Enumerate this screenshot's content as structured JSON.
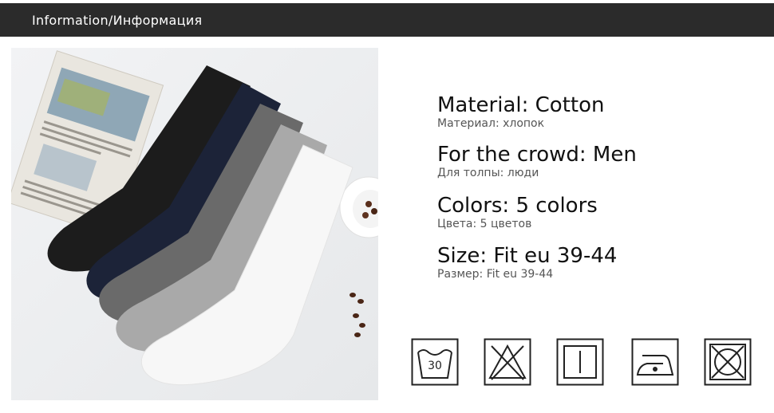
{
  "header": {
    "title": "Information/Информация"
  },
  "specs": [
    {
      "en": "Material: Cotton",
      "ru": "Материал: хлопок"
    },
    {
      "en": "For the crowd: Men",
      "ru": "Для толпы: люди"
    },
    {
      "en": "Colors: 5 colors",
      "ru": "Цвета: 5 цветов"
    },
    {
      "en": "Size: Fit eu 39-44",
      "ru": "Размер: Fit eu 39-44"
    }
  ],
  "care_icons": [
    {
      "icon": "wash-30-icon",
      "label": "30"
    },
    {
      "icon": "do-not-bleach-icon"
    },
    {
      "icon": "line-dry-icon"
    },
    {
      "icon": "iron-low-heat-icon"
    },
    {
      "icon": "do-not-tumble-dry-icon"
    }
  ],
  "colors": {
    "header_bg": "#2b2b2b",
    "sock_black": "#1c1c1c",
    "sock_navy": "#1c2338",
    "sock_dark_gray": "#6a6a6a",
    "sock_light_gray": "#a9a9a9",
    "sock_white": "#f7f7f7"
  }
}
